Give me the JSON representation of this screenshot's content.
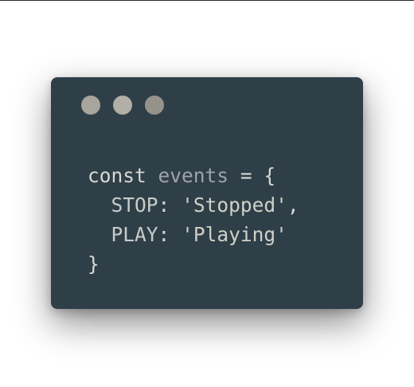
{
  "window": {
    "controls": [
      "circle-1",
      "circle-2",
      "circle-3"
    ],
    "colors": {
      "background": "#2f3f48",
      "dot1": "#a8a59c",
      "dot2": "#b2afa6",
      "dot3": "#8d8a81"
    }
  },
  "code": {
    "line1": {
      "keyword": "const",
      "identifier": "events",
      "operator": "=",
      "open_brace": "{"
    },
    "line2": {
      "key": "STOP",
      "colon": ":",
      "value": "'Stopped'",
      "comma": ","
    },
    "line3": {
      "key": "PLAY",
      "colon": ":",
      "value": "'Playing'"
    },
    "line4": {
      "close_brace": "}"
    }
  }
}
